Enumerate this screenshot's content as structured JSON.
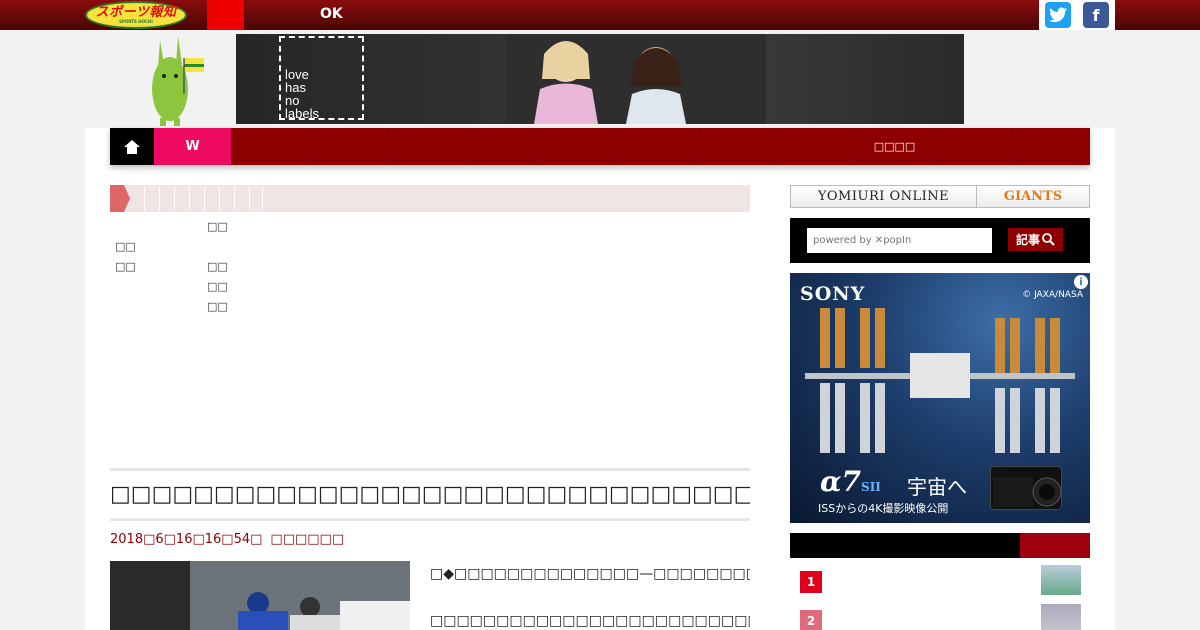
{
  "topbar": {
    "logo_text": "スポーツ報知",
    "logo_sub": "SPORTS HOCHI",
    "ok_text": "OK",
    "twitter_glyph": "t",
    "facebook_glyph": "f"
  },
  "banner_ad": {
    "lines": "love\nhas\nno\nlabels"
  },
  "nav": {
    "w_label": "W",
    "items": [
      "",
      "",
      "",
      "",
      "",
      "",
      "",
      "",
      "□□□□",
      "",
      ""
    ]
  },
  "sublist": {
    "col1": [
      "",
      "□□",
      "□□",
      "",
      ""
    ],
    "col2": [
      "□□",
      "",
      "□□",
      "□□",
      "□□"
    ]
  },
  "article": {
    "headline": "□□□□□□□□□□□□□□□□□□□□□□□□□□□□□□□□□□□□□□□",
    "date": "2018□6□16□16□54□",
    "source": "□□□□□□",
    "body_lines": [
      "□◆□□□□□□□□□□□□□□—□□□□□□□□□□□□□□□□□□□",
      "□□□□□□□□□□□□□□□□□□□□□□□□□□□□□□□"
    ]
  },
  "sidebar": {
    "yomiuri_label": "YOMIURI ONLINE",
    "giants_label": "GIANTS",
    "search_placeholder": "powered by ✕popIn",
    "search_button": "記事",
    "sony_ad": {
      "brand": "SONY",
      "credit": "© JAXA/NASA",
      "model": "α7",
      "model_suffix": "SII",
      "tagline": "宇宙へ",
      "subline": "ISSからの4K撮影映像公開",
      "info": "i"
    },
    "ranking": [
      {
        "rank": "1",
        "color": "#e0001c"
      },
      {
        "rank": "2",
        "color": "#e06a7a"
      }
    ]
  }
}
